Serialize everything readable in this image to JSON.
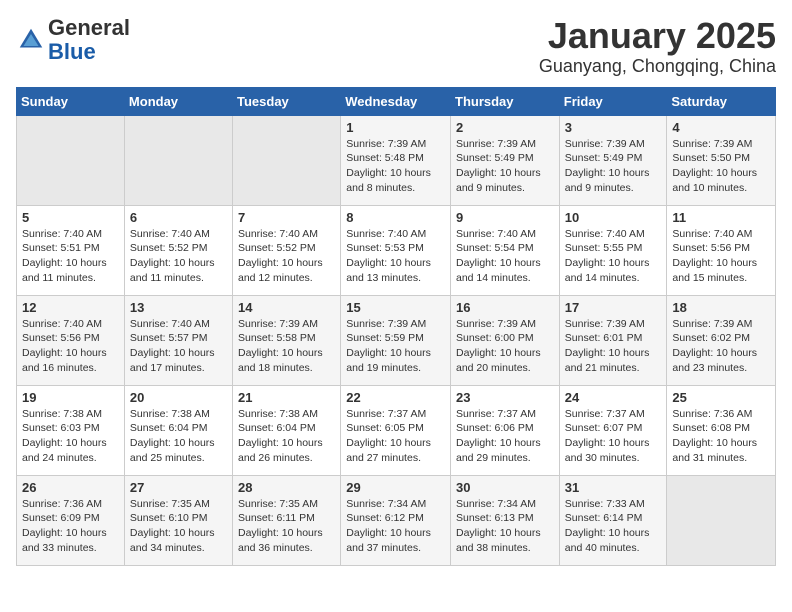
{
  "header": {
    "logo_general": "General",
    "logo_blue": "Blue",
    "title": "January 2025",
    "subtitle": "Guanyang, Chongqing, China"
  },
  "calendar": {
    "days_of_week": [
      "Sunday",
      "Monday",
      "Tuesday",
      "Wednesday",
      "Thursday",
      "Friday",
      "Saturday"
    ],
    "weeks": [
      [
        {
          "day": "",
          "info": ""
        },
        {
          "day": "",
          "info": ""
        },
        {
          "day": "",
          "info": ""
        },
        {
          "day": "1",
          "info": "Sunrise: 7:39 AM\nSunset: 5:48 PM\nDaylight: 10 hours\nand 8 minutes."
        },
        {
          "day": "2",
          "info": "Sunrise: 7:39 AM\nSunset: 5:49 PM\nDaylight: 10 hours\nand 9 minutes."
        },
        {
          "day": "3",
          "info": "Sunrise: 7:39 AM\nSunset: 5:49 PM\nDaylight: 10 hours\nand 9 minutes."
        },
        {
          "day": "4",
          "info": "Sunrise: 7:39 AM\nSunset: 5:50 PM\nDaylight: 10 hours\nand 10 minutes."
        }
      ],
      [
        {
          "day": "5",
          "info": "Sunrise: 7:40 AM\nSunset: 5:51 PM\nDaylight: 10 hours\nand 11 minutes."
        },
        {
          "day": "6",
          "info": "Sunrise: 7:40 AM\nSunset: 5:52 PM\nDaylight: 10 hours\nand 11 minutes."
        },
        {
          "day": "7",
          "info": "Sunrise: 7:40 AM\nSunset: 5:52 PM\nDaylight: 10 hours\nand 12 minutes."
        },
        {
          "day": "8",
          "info": "Sunrise: 7:40 AM\nSunset: 5:53 PM\nDaylight: 10 hours\nand 13 minutes."
        },
        {
          "day": "9",
          "info": "Sunrise: 7:40 AM\nSunset: 5:54 PM\nDaylight: 10 hours\nand 14 minutes."
        },
        {
          "day": "10",
          "info": "Sunrise: 7:40 AM\nSunset: 5:55 PM\nDaylight: 10 hours\nand 14 minutes."
        },
        {
          "day": "11",
          "info": "Sunrise: 7:40 AM\nSunset: 5:56 PM\nDaylight: 10 hours\nand 15 minutes."
        }
      ],
      [
        {
          "day": "12",
          "info": "Sunrise: 7:40 AM\nSunset: 5:56 PM\nDaylight: 10 hours\nand 16 minutes."
        },
        {
          "day": "13",
          "info": "Sunrise: 7:40 AM\nSunset: 5:57 PM\nDaylight: 10 hours\nand 17 minutes."
        },
        {
          "day": "14",
          "info": "Sunrise: 7:39 AM\nSunset: 5:58 PM\nDaylight: 10 hours\nand 18 minutes."
        },
        {
          "day": "15",
          "info": "Sunrise: 7:39 AM\nSunset: 5:59 PM\nDaylight: 10 hours\nand 19 minutes."
        },
        {
          "day": "16",
          "info": "Sunrise: 7:39 AM\nSunset: 6:00 PM\nDaylight: 10 hours\nand 20 minutes."
        },
        {
          "day": "17",
          "info": "Sunrise: 7:39 AM\nSunset: 6:01 PM\nDaylight: 10 hours\nand 21 minutes."
        },
        {
          "day": "18",
          "info": "Sunrise: 7:39 AM\nSunset: 6:02 PM\nDaylight: 10 hours\nand 23 minutes."
        }
      ],
      [
        {
          "day": "19",
          "info": "Sunrise: 7:38 AM\nSunset: 6:03 PM\nDaylight: 10 hours\nand 24 minutes."
        },
        {
          "day": "20",
          "info": "Sunrise: 7:38 AM\nSunset: 6:04 PM\nDaylight: 10 hours\nand 25 minutes."
        },
        {
          "day": "21",
          "info": "Sunrise: 7:38 AM\nSunset: 6:04 PM\nDaylight: 10 hours\nand 26 minutes."
        },
        {
          "day": "22",
          "info": "Sunrise: 7:37 AM\nSunset: 6:05 PM\nDaylight: 10 hours\nand 27 minutes."
        },
        {
          "day": "23",
          "info": "Sunrise: 7:37 AM\nSunset: 6:06 PM\nDaylight: 10 hours\nand 29 minutes."
        },
        {
          "day": "24",
          "info": "Sunrise: 7:37 AM\nSunset: 6:07 PM\nDaylight: 10 hours\nand 30 minutes."
        },
        {
          "day": "25",
          "info": "Sunrise: 7:36 AM\nSunset: 6:08 PM\nDaylight: 10 hours\nand 31 minutes."
        }
      ],
      [
        {
          "day": "26",
          "info": "Sunrise: 7:36 AM\nSunset: 6:09 PM\nDaylight: 10 hours\nand 33 minutes."
        },
        {
          "day": "27",
          "info": "Sunrise: 7:35 AM\nSunset: 6:10 PM\nDaylight: 10 hours\nand 34 minutes."
        },
        {
          "day": "28",
          "info": "Sunrise: 7:35 AM\nSunset: 6:11 PM\nDaylight: 10 hours\nand 36 minutes."
        },
        {
          "day": "29",
          "info": "Sunrise: 7:34 AM\nSunset: 6:12 PM\nDaylight: 10 hours\nand 37 minutes."
        },
        {
          "day": "30",
          "info": "Sunrise: 7:34 AM\nSunset: 6:13 PM\nDaylight: 10 hours\nand 38 minutes."
        },
        {
          "day": "31",
          "info": "Sunrise: 7:33 AM\nSunset: 6:14 PM\nDaylight: 10 hours\nand 40 minutes."
        },
        {
          "day": "",
          "info": ""
        }
      ]
    ]
  }
}
